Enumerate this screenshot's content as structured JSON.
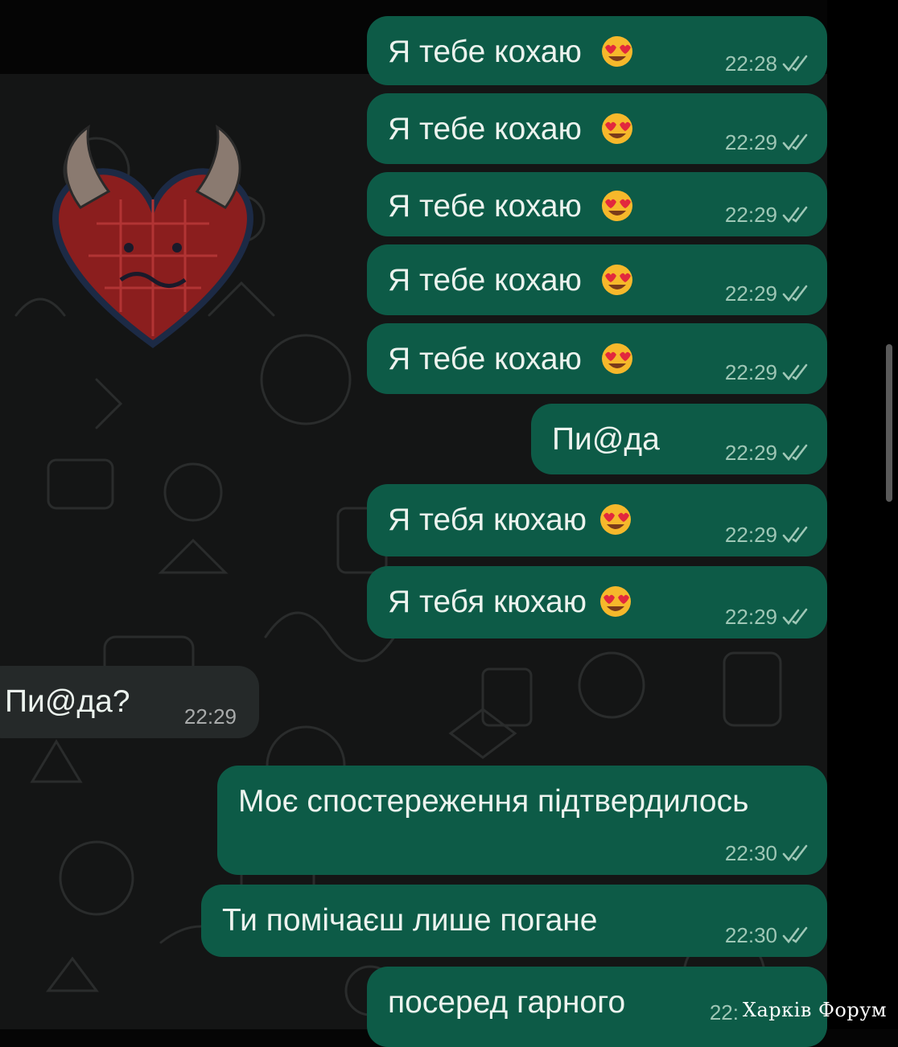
{
  "messages": [
    {
      "direction": "outgoing",
      "text": "Я тебе кохаю",
      "emoji": "heart-eyes",
      "time": "22:28",
      "status": "read"
    },
    {
      "direction": "outgoing",
      "text": "Я тебе кохаю",
      "emoji": "heart-eyes",
      "time": "22:29",
      "status": "read"
    },
    {
      "direction": "outgoing",
      "text": "Я тебе кохаю",
      "emoji": "heart-eyes",
      "time": "22:29",
      "status": "read"
    },
    {
      "direction": "outgoing",
      "text": "Я тебе кохаю",
      "emoji": "heart-eyes",
      "time": "22:29",
      "status": "read"
    },
    {
      "direction": "outgoing",
      "text": "Я тебе кохаю",
      "emoji": "heart-eyes",
      "time": "22:29",
      "status": "read"
    },
    {
      "direction": "outgoing",
      "text": "Пи@да",
      "time": "22:29",
      "status": "read"
    },
    {
      "direction": "outgoing",
      "text": "Я тебя кюхаю",
      "emoji": "heart-eyes",
      "time": "22:29",
      "status": "read"
    },
    {
      "direction": "outgoing",
      "text": "Я тебя кюхаю",
      "emoji": "heart-eyes",
      "time": "22:29",
      "status": "read"
    },
    {
      "direction": "incoming",
      "text": "Пи@да?",
      "time": "22:29"
    },
    {
      "direction": "outgoing",
      "text": "Моє спостереження підтвердилось",
      "time": "22:30",
      "status": "read"
    },
    {
      "direction": "outgoing",
      "text": "Ти помічаєш лише погане",
      "time": "22:30",
      "status": "read"
    },
    {
      "direction": "outgoing",
      "text": "посеред гарного",
      "time": "22:",
      "status": "read"
    }
  ],
  "sticker": {
    "icon": "devil-heart-sticker"
  },
  "watermark": "Харків Форум",
  "colors": {
    "outgoing_bubble": "#0d5b47",
    "incoming_bubble": "#252929",
    "chat_background": "#141515",
    "text": "#ecf3ee"
  }
}
